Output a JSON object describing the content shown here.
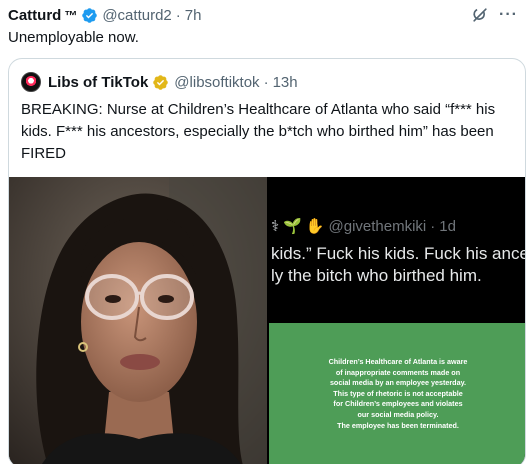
{
  "tweet": {
    "author_name": "Catturd",
    "tm": "™",
    "handle": "@catturd2",
    "dot": "·",
    "time": "7h",
    "text": "Unemployable now."
  },
  "quote": {
    "author_name": "Libs of TikTok",
    "handle": "@libsoftiktok",
    "dot": "·",
    "time": "13h",
    "text": "BREAKING: Nurse at Children’s Healthcare of Atlanta who said “f*** his kids. F*** his ancestors, especially the b*tch who birthed him” has been FIRED"
  },
  "media": {
    "screenshot_handle": "@givethemkiki",
    "screenshot_dot": "·",
    "screenshot_time": "1d",
    "screenshot_line1": "kids.” Fuck his kids. Fuck his ancest",
    "screenshot_line2": "ly the bitch who birthed him.",
    "statement_lines": [
      "Children’s Healthcare of Atlanta is aware",
      "of inappropriate comments made on",
      "social media by an employee yesterday.",
      "This type of rhetoric is not acceptable",
      "for Children’s employees and violates",
      "our social media policy.",
      "The employee has been terminated."
    ]
  },
  "colors": {
    "verified_blue": "#1d9bf0",
    "verified_gold": "#e2b719",
    "statement_green": "#4e9d57"
  }
}
